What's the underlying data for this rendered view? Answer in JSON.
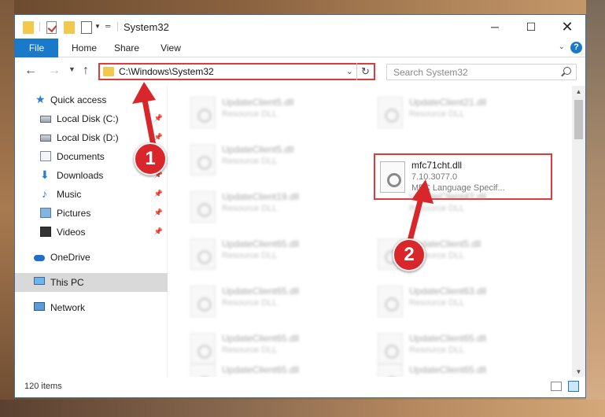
{
  "window": {
    "title": "System32",
    "controls": {
      "minimize": "─",
      "maximize": "☐",
      "close": "✕"
    }
  },
  "ribbon": {
    "tabs": [
      "File",
      "Home",
      "Share",
      "View"
    ],
    "help": "?"
  },
  "addressbar": {
    "path": "C:\\Windows\\System32",
    "search_placeholder": "Search System32"
  },
  "navpane": {
    "items": [
      {
        "label": "Quick access",
        "icon": "star-icon",
        "pinned": false
      },
      {
        "label": "Local Disk (C:)",
        "icon": "drive-icon",
        "pinned": true
      },
      {
        "label": "Local Disk (D:)",
        "icon": "drive-icon",
        "pinned": true
      },
      {
        "label": "Documents",
        "icon": "documents-icon",
        "pinned": true
      },
      {
        "label": "Downloads",
        "icon": "download-icon",
        "pinned": true
      },
      {
        "label": "Music",
        "icon": "music-icon",
        "pinned": true
      },
      {
        "label": "Pictures",
        "icon": "pictures-icon",
        "pinned": true
      },
      {
        "label": "Videos",
        "icon": "videos-icon",
        "pinned": true
      },
      {
        "label": "OneDrive",
        "icon": "cloud-icon",
        "pinned": false
      },
      {
        "label": "This PC",
        "icon": "pc-icon",
        "pinned": false,
        "selected": true
      },
      {
        "label": "Network",
        "icon": "network-icon",
        "pinned": false
      }
    ]
  },
  "files": {
    "left_column": [
      {
        "name": "UpdateClient5.dll",
        "type": "Resource DLL"
      },
      {
        "name": "UpdateClient5.dll",
        "type": "Resource DLL"
      },
      {
        "name": "UpdateClient19.dll",
        "type": "Resource DLL"
      },
      {
        "name": "UpdateClient65.dll",
        "type": "Resource DLL"
      },
      {
        "name": "UpdateClient65.dll",
        "type": "Resource DLL"
      },
      {
        "name": "UpdateClient65.dll",
        "type": "Resource DLL"
      },
      {
        "name": "UpdateClient65.dll",
        "type": "Resource DLL"
      }
    ],
    "right_column": [
      {
        "name": "UpdateClient21.dll",
        "type": "Resource DLL"
      },
      {
        "name": "UpdateClient42.dll",
        "type": "Resource DLL"
      },
      {
        "name": "UpdateClient5.dll",
        "type": "Resource DLL"
      },
      {
        "name": "UpdateClient63.dll",
        "type": "Resource DLL"
      },
      {
        "name": "UpdateClient65.dll",
        "type": "Resource DLL"
      },
      {
        "name": "UpdateClient65.dll",
        "type": "Resource DLL"
      }
    ],
    "highlighted": {
      "name": "mfc71cht.dll",
      "version": "7.10.3077.0",
      "description": "MFC Language Specif..."
    }
  },
  "status": {
    "item_count": "120 items"
  },
  "callouts": {
    "one": "1",
    "two": "2"
  },
  "colors": {
    "accent": "#1979ca",
    "highlight": "#e03b3b",
    "badge": "#d8262a"
  }
}
